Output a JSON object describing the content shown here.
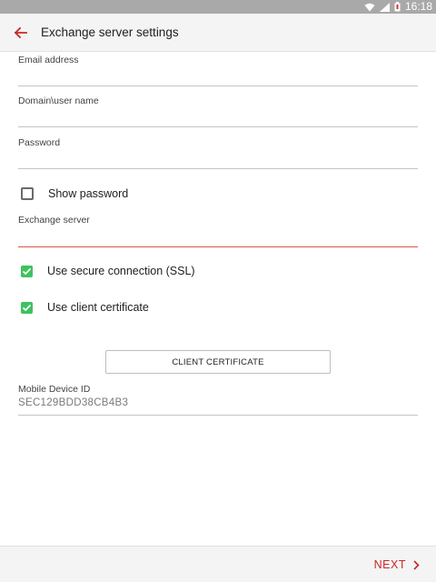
{
  "status_bar": {
    "time": "16:18"
  },
  "app_bar": {
    "title": "Exchange server settings"
  },
  "fields": {
    "email": {
      "label": "Email address",
      "value": ""
    },
    "domain_user": {
      "label": "Domain\\user name",
      "value": ""
    },
    "password": {
      "label": "Password",
      "value": ""
    },
    "exchange_server": {
      "label": "Exchange server",
      "value": ""
    }
  },
  "checkboxes": {
    "show_password": {
      "label": "Show password",
      "checked": false
    },
    "use_ssl": {
      "label": "Use secure connection (SSL)",
      "checked": true
    },
    "client_cert": {
      "label": "Use client certificate",
      "checked": true
    }
  },
  "client_certificate_button": {
    "label": "CLIENT CERTIFICATE"
  },
  "mobile_device": {
    "label": "Mobile Device ID",
    "value": "SEC129BDD38CB4B3"
  },
  "footer": {
    "next_label": "NEXT"
  },
  "colors": {
    "accent_red": "#c62828",
    "active_line": "#d9554d",
    "check_green": "#3ec25f"
  }
}
